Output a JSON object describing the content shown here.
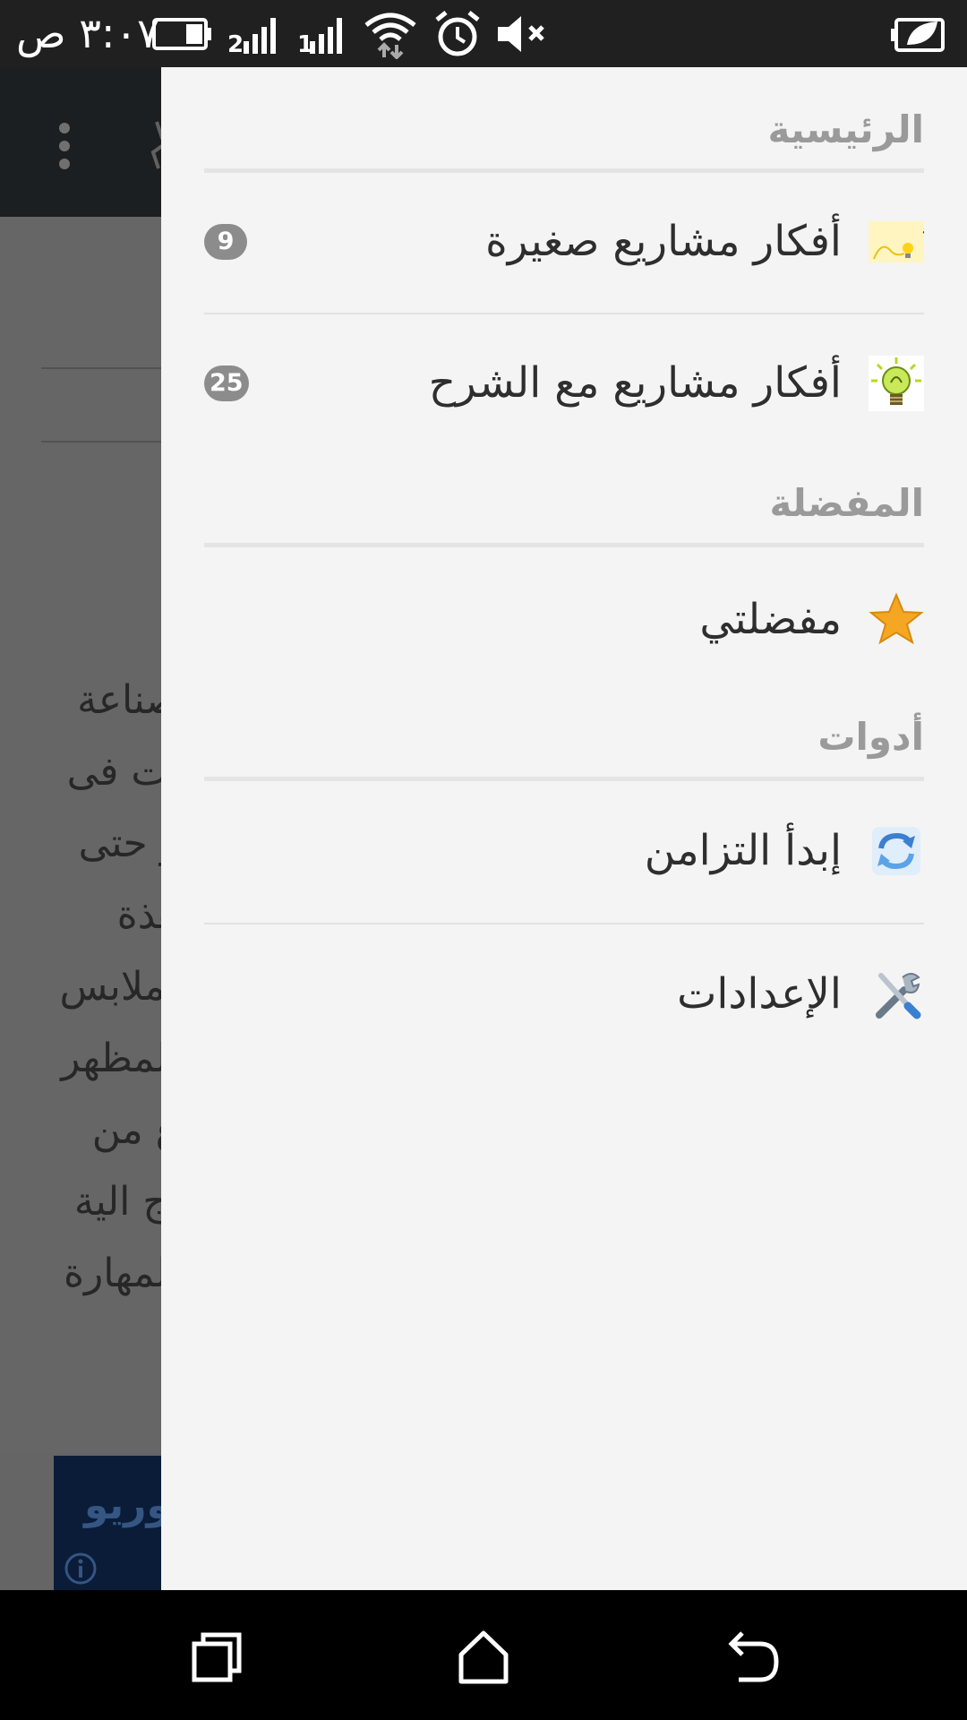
{
  "status_bar": {
    "time": "٣:٠٧ ص",
    "icons": [
      "battery-icon",
      "signal-2g-icon",
      "signal-icon",
      "wifi-icon",
      "alarm-icon",
      "mute-icon",
      "battery-saver-icon"
    ]
  },
  "background": {
    "text_lines": [
      "صناعة",
      "ات فى",
      "و حتى",
      "هذة",
      "لملابس",
      "المظهر",
      "ع من",
      "اج الية",
      "المهارة",
      "."
    ],
    "ad_text": "وريو"
  },
  "drawer": {
    "sections": [
      {
        "header": "الرئيسية",
        "items": [
          {
            "label": "أفكار مشاريع صغيرة",
            "badge": "9",
            "icon": "ideas-lightbulb-icon"
          },
          {
            "label": "أفكار مشاريع مع الشرح",
            "badge": "25",
            "icon": "lightbulb-icon"
          }
        ]
      },
      {
        "header": "المفضلة",
        "items": [
          {
            "label": "مفضلتي",
            "icon": "star-icon"
          }
        ]
      },
      {
        "header": "أدوات",
        "items": [
          {
            "label": "إبدأ التزامن",
            "icon": "sync-icon"
          },
          {
            "label": "الإعدادات",
            "icon": "settings-tools-icon"
          }
        ]
      }
    ]
  },
  "nav_bar": {
    "buttons": [
      "recents-icon",
      "home-icon",
      "back-icon"
    ]
  },
  "colors": {
    "drawer_bg": "#f4f4f4",
    "header_text": "#9a9a9a",
    "badge_bg": "#8c8c8c",
    "status_bar_bg": "#202020",
    "star": "#f5a623",
    "sync_blue": "#4a90d9"
  }
}
